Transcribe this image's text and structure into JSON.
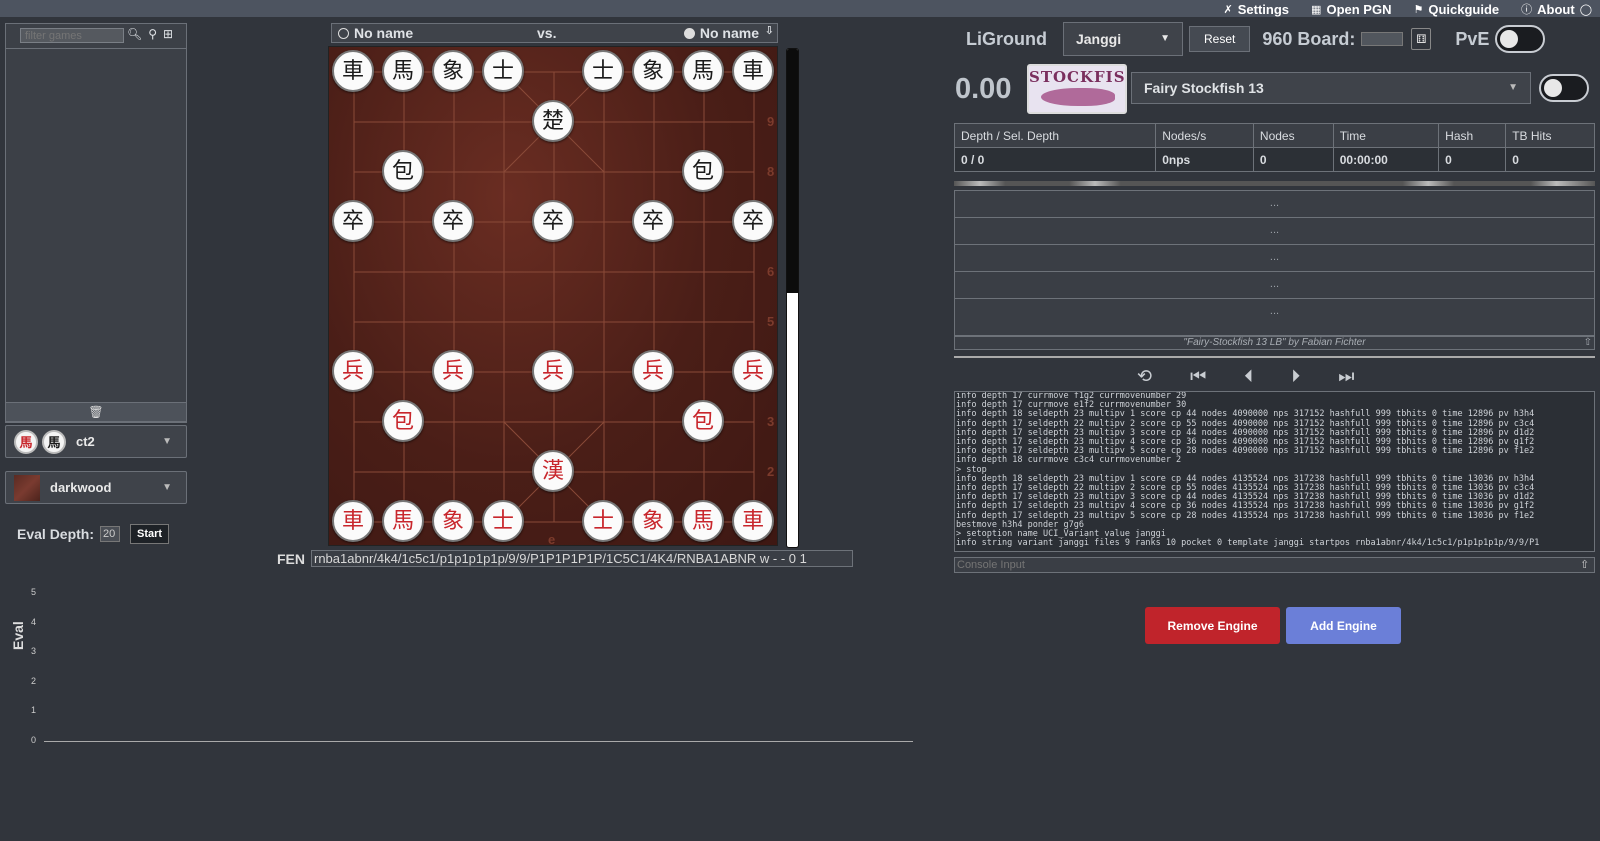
{
  "topmenu": [
    {
      "icon": "✗",
      "icon_name": "settings-icon",
      "label": "Settings"
    },
    {
      "icon": "▦",
      "icon_name": "open-pgn-icon",
      "label": "Open PGN"
    },
    {
      "icon": "⚑",
      "icon_name": "quickguide-icon",
      "label": "Quickguide"
    },
    {
      "icon": "ⓘ",
      "icon_name": "about-icon",
      "label": "About"
    }
  ],
  "sidebar": {
    "filter_placeholder": "filter games",
    "piece_set": "ct2",
    "board_theme": "darkwood",
    "eval_depth_label": "Eval Depth:",
    "eval_depth_value": "20",
    "start_label": "Start"
  },
  "evalchart": {
    "ylabel": "Eval",
    "ticks": [
      "5",
      "4",
      "3",
      "2",
      "1",
      "0"
    ]
  },
  "players": {
    "white": "No name",
    "vs": "vs.",
    "black": "No name"
  },
  "board": {
    "rank_labels": [
      "9",
      "8",
      "6",
      "5",
      "3",
      "2"
    ],
    "file_label": "e",
    "pieces": [
      {
        "c": "b",
        "g": "車",
        "x": 0,
        "y": 0
      },
      {
        "c": "b",
        "g": "馬",
        "x": 1,
        "y": 0
      },
      {
        "c": "b",
        "g": "象",
        "x": 2,
        "y": 0
      },
      {
        "c": "b",
        "g": "士",
        "x": 3,
        "y": 0
      },
      {
        "c": "b",
        "g": "士",
        "x": 5,
        "y": 0
      },
      {
        "c": "b",
        "g": "象",
        "x": 6,
        "y": 0
      },
      {
        "c": "b",
        "g": "馬",
        "x": 7,
        "y": 0
      },
      {
        "c": "b",
        "g": "車",
        "x": 8,
        "y": 0
      },
      {
        "c": "b",
        "g": "楚",
        "x": 4,
        "y": 1
      },
      {
        "c": "b",
        "g": "包",
        "x": 1,
        "y": 2
      },
      {
        "c": "b",
        "g": "包",
        "x": 7,
        "y": 2
      },
      {
        "c": "b",
        "g": "卒",
        "x": 0,
        "y": 3
      },
      {
        "c": "b",
        "g": "卒",
        "x": 2,
        "y": 3
      },
      {
        "c": "b",
        "g": "卒",
        "x": 4,
        "y": 3
      },
      {
        "c": "b",
        "g": "卒",
        "x": 6,
        "y": 3
      },
      {
        "c": "b",
        "g": "卒",
        "x": 8,
        "y": 3
      },
      {
        "c": "r",
        "g": "兵",
        "x": 0,
        "y": 6
      },
      {
        "c": "r",
        "g": "兵",
        "x": 2,
        "y": 6
      },
      {
        "c": "r",
        "g": "兵",
        "x": 4,
        "y": 6
      },
      {
        "c": "r",
        "g": "兵",
        "x": 6,
        "y": 6
      },
      {
        "c": "r",
        "g": "兵",
        "x": 8,
        "y": 6
      },
      {
        "c": "r",
        "g": "包",
        "x": 1,
        "y": 7
      },
      {
        "c": "r",
        "g": "包",
        "x": 7,
        "y": 7
      },
      {
        "c": "r",
        "g": "漢",
        "x": 4,
        "y": 8
      },
      {
        "c": "r",
        "g": "車",
        "x": 0,
        "y": 9
      },
      {
        "c": "r",
        "g": "馬",
        "x": 1,
        "y": 9
      },
      {
        "c": "r",
        "g": "象",
        "x": 2,
        "y": 9
      },
      {
        "c": "r",
        "g": "士",
        "x": 3,
        "y": 9
      },
      {
        "c": "r",
        "g": "士",
        "x": 5,
        "y": 9
      },
      {
        "c": "r",
        "g": "象",
        "x": 6,
        "y": 9
      },
      {
        "c": "r",
        "g": "馬",
        "x": 7,
        "y": 9
      },
      {
        "c": "r",
        "g": "車",
        "x": 8,
        "y": 9
      }
    ]
  },
  "fen": {
    "label": "FEN",
    "value": "rnba1abnr/4k4/1c5c1/p1p1p1p1p/9/9/P1P1P1P1P/1C5C1/4K4/RNBA1ABNR w - - 0 1"
  },
  "engine": {
    "brand": "LiGround",
    "variant": "Janggi",
    "reset_label": "Reset",
    "board960_label": "960 Board:",
    "pve_label": "PvE",
    "score": "0.00",
    "logo_text": "STOCKFISH",
    "engine_name": "Fairy Stockfish 13",
    "eval_bar_black_fraction": 0.49,
    "stats_headers": [
      "Depth / Sel. Depth",
      "Nodes/s",
      "Nodes",
      "Time",
      "Hash",
      "TB Hits"
    ],
    "stats_values": [
      "0 / 0",
      "0nps",
      "0",
      "00:00:00",
      "0",
      "0"
    ],
    "pv_lines": [
      "...",
      "...",
      "...",
      "...",
      "..."
    ],
    "credit": "\"Fairy-Stockfish 13 LB\" by Fabian Fichter",
    "console_placeholder": "Console Input",
    "remove_label": "Remove Engine",
    "add_label": "Add Engine"
  },
  "console_lines": [
    "info depth 17 currmove f1g2 currmovenumber 29",
    "info depth 17 currmove e1f2 currmovenumber 30",
    "info depth 18 seldepth 23 multipv 1 score cp 44 nodes 4090000 nps 317152 hashfull 999 tbhits 0 time 12896 pv h3h4",
    "info depth 17 seldepth 22 multipv 2 score cp 55 nodes 4090000 nps 317152 hashfull 999 tbhits 0 time 12896 pv c3c4",
    "info depth 17 seldepth 23 multipv 3 score cp 44 nodes 4090000 nps 317152 hashfull 999 tbhits 0 time 12896 pv d1d2",
    "info depth 17 seldepth 23 multipv 4 score cp 36 nodes 4090000 nps 317152 hashfull 999 tbhits 0 time 12896 pv g1f2",
    "info depth 17 seldepth 23 multipv 5 score cp 28 nodes 4090000 nps 317152 hashfull 999 tbhits 0 time 12896 pv f1e2",
    "info depth 18 currmove c3c4 currmovenumber 2",
    "> stop",
    "info depth 18 seldepth 23 multipv 1 score cp 44 nodes 4135524 nps 317238 hashfull 999 tbhits 0 time 13036 pv h3h4",
    "info depth 17 seldepth 22 multipv 2 score cp 55 nodes 4135524 nps 317238 hashfull 999 tbhits 0 time 13036 pv c3c4",
    "info depth 17 seldepth 23 multipv 3 score cp 44 nodes 4135524 nps 317238 hashfull 999 tbhits 0 time 13036 pv d1d2",
    "info depth 17 seldepth 23 multipv 4 score cp 36 nodes 4135524 nps 317238 hashfull 999 tbhits 0 time 13036 pv g1f2",
    "info depth 17 seldepth 23 multipv 5 score cp 28 nodes 4135524 nps 317238 hashfull 999 tbhits 0 time 13036 pv f1e2",
    "bestmove h3h4 ponder g7g6",
    "> setoption name UCI_Variant value janggi",
    "info string variant janggi files 9 ranks 10 pocket 0 template janggi startpos rnba1abnr/4k4/1c5c1/p1p1p1p1p/9/9/P1"
  ]
}
